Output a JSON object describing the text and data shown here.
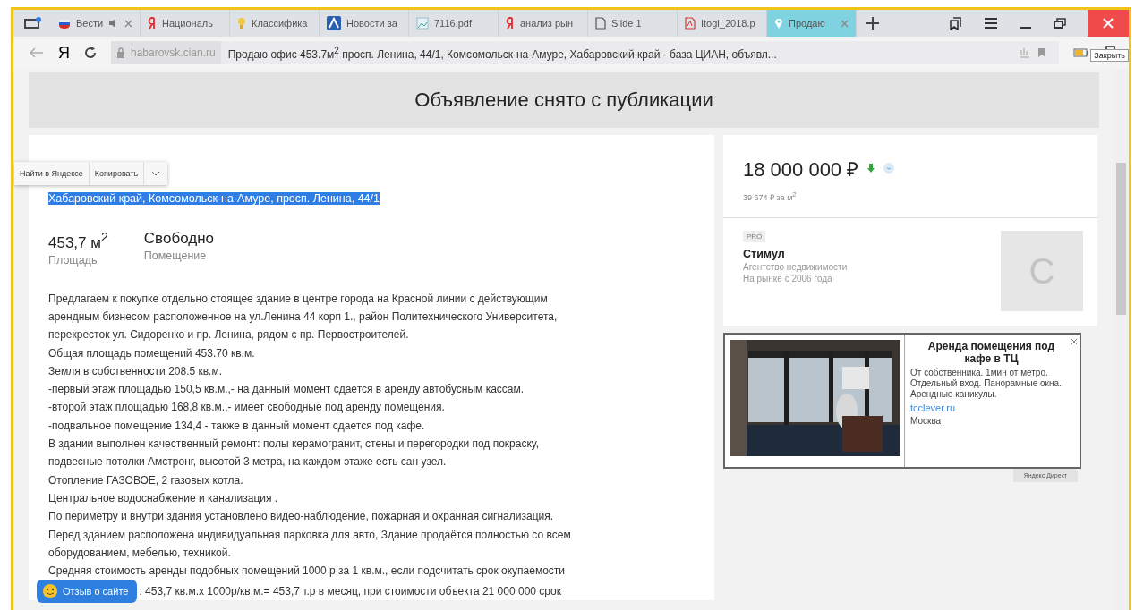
{
  "browser": {
    "tabs": [
      {
        "title": "Вести",
        "selected": false,
        "muted": true,
        "closable": true
      },
      {
        "title": "Националь",
        "selected": false,
        "muted": false,
        "closable": false
      },
      {
        "title": "Классифика",
        "selected": false,
        "muted": false,
        "closable": false
      },
      {
        "title": "Новости за",
        "selected": false,
        "muted": false,
        "closable": false
      },
      {
        "title": "7116.pdf",
        "selected": false,
        "muted": false,
        "closable": false
      },
      {
        "title": "анализ рын",
        "selected": false,
        "muted": false,
        "closable": false
      },
      {
        "title": "Slide 1",
        "selected": false,
        "muted": false,
        "closable": false
      },
      {
        "title": "Itogi_2018.p",
        "selected": false,
        "muted": false,
        "closable": false
      },
      {
        "title": "Продаю",
        "selected": true,
        "muted": false,
        "closable": true
      }
    ],
    "yandex_button": "Я",
    "address": {
      "domain": "habarovsk.cian.ru",
      "title": "Продаю офис 453.7м$^{2}$ просп. Ленина, 44/1, Комсомольск-на-Амуре, Хабаровский край - база ЦИАН, объявл..."
    },
    "tooltip": "Закрыть"
  },
  "page": {
    "banner": "Объявление снято с публикации",
    "context_menu": [
      "Найти в Яндексе",
      "Копировать"
    ],
    "address_selected": "Хабаровский край, Комсомольск-на-Амуре, просп. Ленина, 44/1",
    "facts": [
      {
        "value": "453,7 м$^{2}$",
        "label": "Площадь"
      },
      {
        "value": "Свободно",
        "label": "Помещение"
      }
    ],
    "description": [
      "Предлагаем к покупке отдельно стоящее здание в центре города на Красной линии с действующим",
      "арендным бизнесом расположенное на ул.Ленина 44 корп 1., район Политехнического Университета,",
      "перекресток ул. Сидоренко и пр. Ленина, рядом с пр. Первостроителей.",
      "Общая площадь помещений 453.70 кв.м.",
      "Земля в собственности 208.5 кв.м.",
      "-первый этаж площадью 150,5 кв.м.,- на данный момент сдается в аренду автобусным кассам.",
      "-второй этаж площадью 168,8 кв.м.,- имеет свободные под аренду помещения.",
      "-подвальное помещение 134,4 - также в данный момент сдается под кафе.",
      "В здании выполнен качественный ремонт: полы керамогранит, стены и перегородки под покраску,",
      "подвесные потолки Амстронг, высотой 3 метра, на каждом этаже есть сан узел.",
      "Отопление ГАЗОВОЕ, 2 газовых котла.",
      "Центральное водоснабжение и канализация .",
      "По периметру и внутри здания установлено видео-наблюдение, пожарная и охранная сигнализация.",
      "Перед зданием расположена индивидуальная парковка для авто, Здание продаётся полностью со всем",
      "оборудованием, мебелью, техникой.",
      "Средняя стоимость аренды подобных помещений 1000 р за 1 кв.м., если подсчитать срок окупаемости"
    ],
    "description_partial": ": 453,7 кв.м.х 1000р/кв.м.= 453,7 т.р в месяц, при стоимости объекта 21 000 000 срок",
    "feedback_button": "Отзыв о сайте",
    "price": {
      "amount": "18 000 000 ₽",
      "per_meter": "39 674 ₽ за м$^{2}$"
    },
    "agent": {
      "badge": "PRO",
      "name": "Стимул",
      "type": "Агентство недвижимости",
      "since": "На рынке с 2006 года",
      "avatar": "С"
    },
    "ad": {
      "kind": "picture",
      "title": "Аренда помещения под кафе в ТЦ",
      "text": "От собственника. 1мин от метро. Отдельный вход. Панорамные окна. Арендные каникулы.",
      "link": "tcclever.ru",
      "city": "Москва",
      "label": "Яндекс Директ"
    }
  }
}
